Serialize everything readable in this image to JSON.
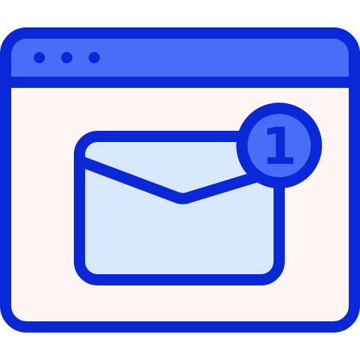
{
  "icon": {
    "name": "browser-mail-notification-icon",
    "badge_count": "1"
  },
  "colors": {
    "outline": "#0a28d8",
    "titlebar": "#4a6cf7",
    "window_bg": "#fff5f5",
    "envelope_fill": "#d7e8ff",
    "badge_fill": "#4a6cf7",
    "page_bg": "#ffffff"
  }
}
